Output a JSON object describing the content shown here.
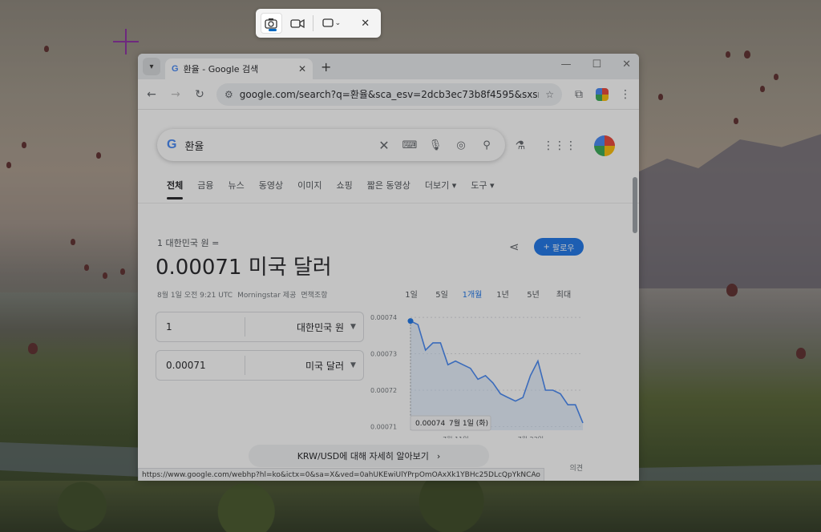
{
  "snip_toolbar": {
    "photo_icon": "camera-icon",
    "video_icon": "video-icon",
    "mode_icon": "rectangle-snip-icon",
    "close_icon": "close-icon"
  },
  "browser": {
    "tab_title": "환율 - Google 검색",
    "url": "google.com/search?q=환율&sca_esv=2dcb3ec73b8f4595&sxsrf=...",
    "status_url": "https://www.google.com/webhp?hl=ko&ictx=0&sa=X&ved=0ahUKEwiUlYPrpOmOAxXk1YBHc25DLcQpYkNCAo"
  },
  "search": {
    "query": "환율",
    "logo": "G"
  },
  "tabs": [
    "전체",
    "금융",
    "뉴스",
    "동영상",
    "이미지",
    "쇼핑",
    "짧은 동영상",
    "더보기 ▾",
    "도구 ▾"
  ],
  "converter": {
    "from_label": "1 대한민국 원 =",
    "result": "0.00071 미국 달러",
    "timestamp": "8월 1일 오전 9:21 UTC",
    "source": "Morningstar 제공",
    "disclaimer": "면책조항",
    "follow_label": "팔로우",
    "from_amount": "1",
    "from_currency": "대한민국 원",
    "to_amount": "0.00071",
    "to_currency": "미국 달러"
  },
  "ranges": [
    "1일",
    "5일",
    "1개월",
    "1년",
    "5년",
    "최대"
  ],
  "active_range": "1개월",
  "learn_more": "KRW/USD에 대해 자세히 알아보기",
  "feedback": "의견",
  "chart_data": {
    "type": "area",
    "y_ticks": [
      "0.00074",
      "0.00073",
      "0.00072",
      "0.00071"
    ],
    "ylim": [
      0.000709,
      0.000742
    ],
    "x_ticks": [
      "7월 11일",
      "7월 23일"
    ],
    "tooltip": {
      "value": "0.00074",
      "date": "7월 1일 (화)"
    },
    "values": [
      0.000739,
      0.000738,
      0.000731,
      0.000733,
      0.000733,
      0.000727,
      0.000728,
      0.000727,
      0.000726,
      0.000723,
      0.000724,
      0.000722,
      0.000719,
      0.000718,
      0.000717,
      0.000718,
      0.000724,
      0.000728,
      0.00072,
      0.00072,
      0.000719,
      0.000716,
      0.000716,
      0.000711
    ],
    "line_color": "#4285f4"
  }
}
